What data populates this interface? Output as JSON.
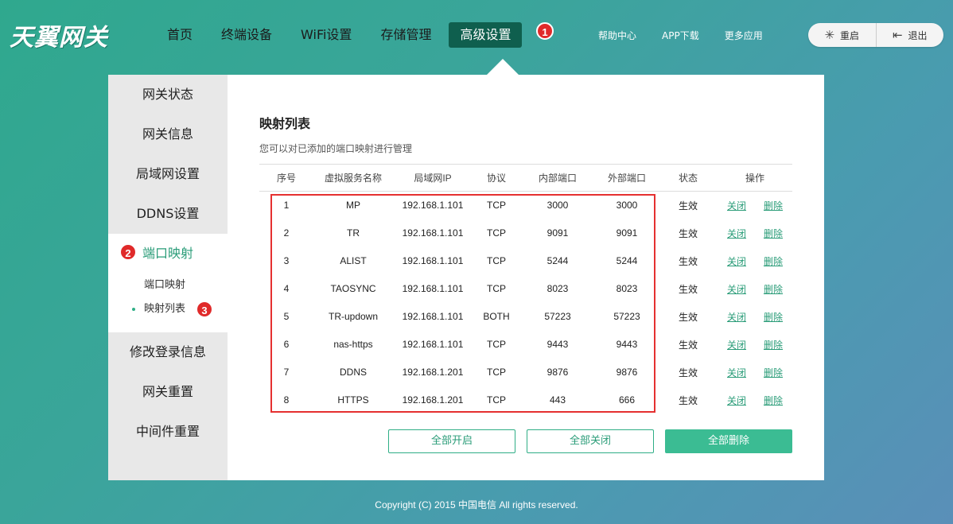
{
  "logo": "天翼网关",
  "nav": [
    "首页",
    "终端设备",
    "WiFi设置",
    "存储管理",
    "高级设置"
  ],
  "nav_active_index": 4,
  "header_links": [
    "帮助中心",
    "APP下载",
    "更多应用"
  ],
  "actions": {
    "restart": "重启",
    "logout": "退出"
  },
  "badges": {
    "b1": "1",
    "b2": "2",
    "b3": "3"
  },
  "sidebar": {
    "items": [
      "网关状态",
      "网关信息",
      "局域网设置",
      "DDNS设置",
      "端口映射"
    ],
    "sub_items": [
      "端口映射",
      "映射列表"
    ],
    "items_after": [
      "修改登录信息",
      "网关重置",
      "中间件重置"
    ]
  },
  "main": {
    "title": "映射列表",
    "desc": "您可以对已添加的端口映射进行管理",
    "columns": [
      "序号",
      "虚拟服务名称",
      "局域网IP",
      "协议",
      "内部端口",
      "外部端口",
      "状态",
      "操作"
    ],
    "rows": [
      {
        "no": "1",
        "name": "MP",
        "ip": "192.168.1.101",
        "proto": "TCP",
        "in": "3000",
        "out": "3000",
        "status": "生效",
        "close": "关闭",
        "del": "删除"
      },
      {
        "no": "2",
        "name": "TR",
        "ip": "192.168.1.101",
        "proto": "TCP",
        "in": "9091",
        "out": "9091",
        "status": "生效",
        "close": "关闭",
        "del": "删除"
      },
      {
        "no": "3",
        "name": "ALIST",
        "ip": "192.168.1.101",
        "proto": "TCP",
        "in": "5244",
        "out": "5244",
        "status": "生效",
        "close": "关闭",
        "del": "删除"
      },
      {
        "no": "4",
        "name": "TAOSYNC",
        "ip": "192.168.1.101",
        "proto": "TCP",
        "in": "8023",
        "out": "8023",
        "status": "生效",
        "close": "关闭",
        "del": "删除"
      },
      {
        "no": "5",
        "name": "TR-updown",
        "ip": "192.168.1.101",
        "proto": "BOTH",
        "in": "57223",
        "out": "57223",
        "status": "生效",
        "close": "关闭",
        "del": "删除"
      },
      {
        "no": "6",
        "name": "nas-https",
        "ip": "192.168.1.101",
        "proto": "TCP",
        "in": "9443",
        "out": "9443",
        "status": "生效",
        "close": "关闭",
        "del": "删除"
      },
      {
        "no": "7",
        "name": "DDNS",
        "ip": "192.168.1.201",
        "proto": "TCP",
        "in": "9876",
        "out": "9876",
        "status": "生效",
        "close": "关闭",
        "del": "删除"
      },
      {
        "no": "8",
        "name": "HTTPS",
        "ip": "192.168.1.201",
        "proto": "TCP",
        "in": "443",
        "out": "666",
        "status": "生效",
        "close": "关闭",
        "del": "删除"
      }
    ],
    "buttons": {
      "enable_all": "全部开启",
      "close_all": "全部关闭",
      "delete_all": "全部删除"
    }
  },
  "footer": "Copyright (C) 2015 中国电信 All rights reserved.",
  "colors": {
    "accent": "#2fae86",
    "active_nav": "#0f5f4e",
    "highlight": "#e53030"
  }
}
